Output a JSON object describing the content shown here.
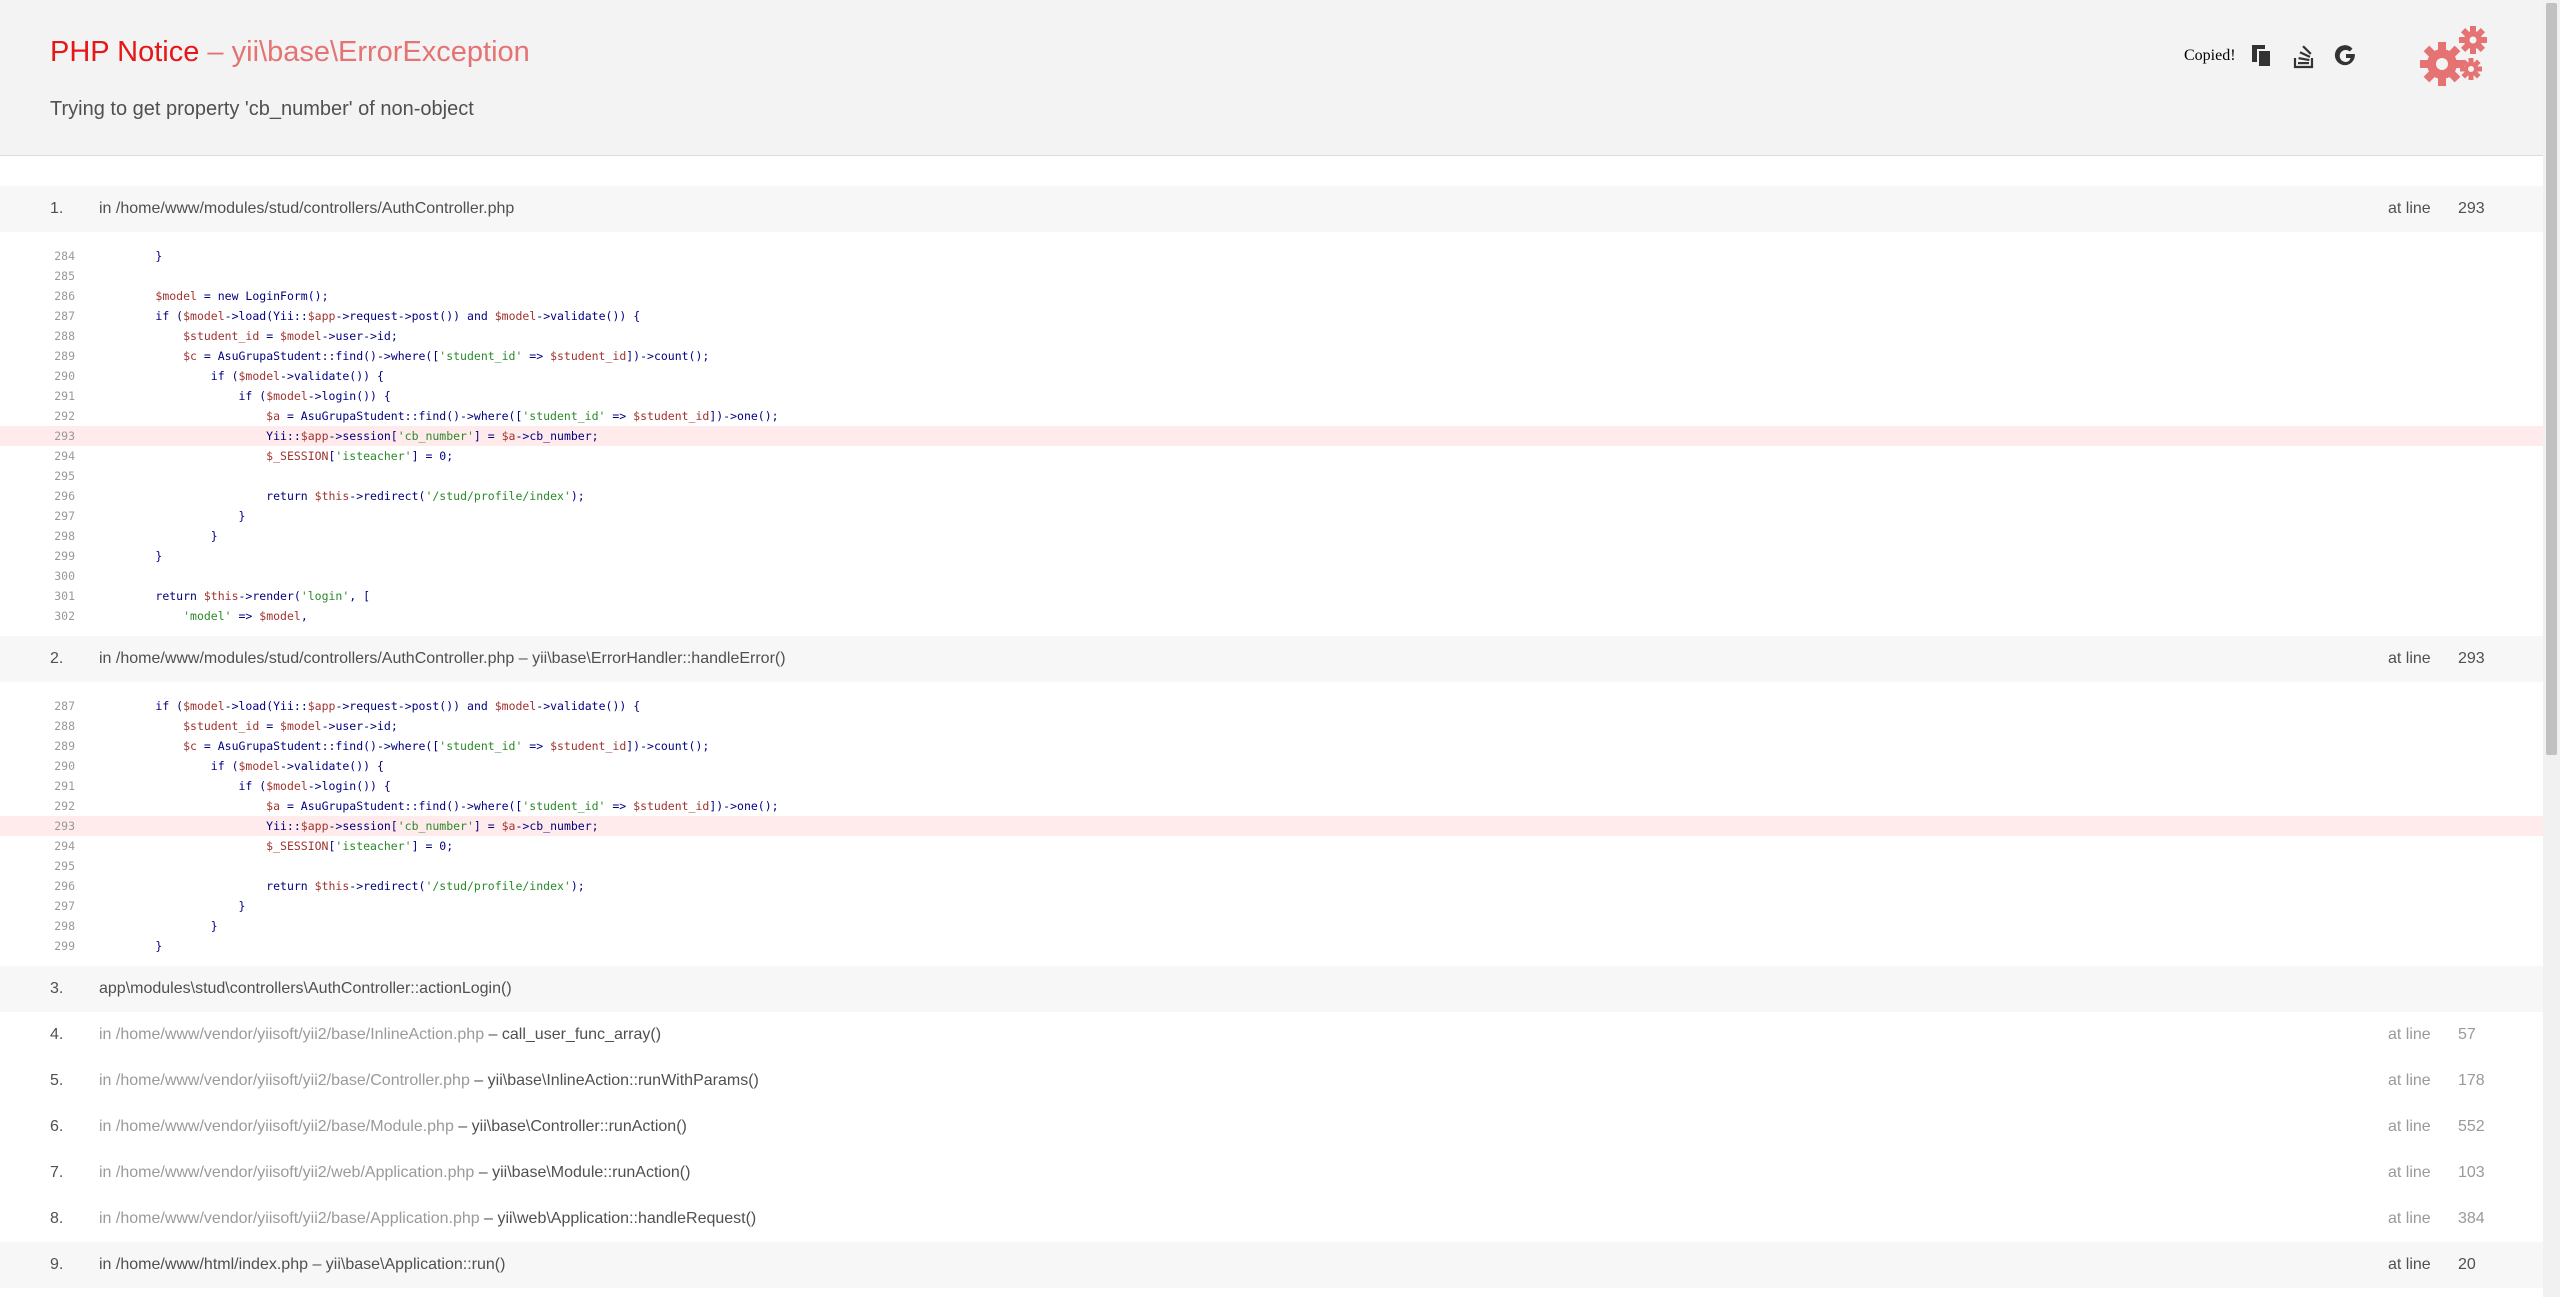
{
  "header": {
    "title": "PHP Notice",
    "title_sep": " – ",
    "exception": "yii\\base\\ErrorException",
    "message": "Trying to get property 'cb_number' of non-object",
    "copied_label": "Copied!",
    "icons": [
      "copy-icon",
      "stackoverflow-icon",
      "google-icon",
      "gear-logo"
    ]
  },
  "at_line_label": "at line",
  "frames": [
    {
      "num": "1.",
      "prefix": "in ",
      "path": "/home/www/modules/stud/controllers/AuthController.php",
      "call": "",
      "line": "293",
      "code": [
        [
          "284",
          "        }"
        ],
        [
          "285",
          ""
        ],
        [
          "286",
          "        $model = new LoginForm();"
        ],
        [
          "287",
          "        if ($model->load(Yii::$app->request->post()) and $model->validate()) {"
        ],
        [
          "288",
          "            $student_id = $model->user->id;"
        ],
        [
          "289",
          "            $c = AsuGrupaStudent::find()->where(['student_id' => $student_id])->count();"
        ],
        [
          "290",
          "                if ($model->validate()) {"
        ],
        [
          "291",
          "                    if ($model->login()) {"
        ],
        [
          "292",
          "                        $a = AsuGrupaStudent::find()->where(['student_id' => $student_id])->one();"
        ],
        [
          "293",
          "                        Yii::$app->session['cb_number'] = $a->cb_number;"
        ],
        [
          "294",
          "                        $_SESSION['isteacher'] = 0;"
        ],
        [
          "295",
          ""
        ],
        [
          "296",
          "                        return $this->redirect('/stud/profile/index');"
        ],
        [
          "297",
          "                    }"
        ],
        [
          "298",
          "                }"
        ],
        [
          "299",
          "        }"
        ],
        [
          "300",
          ""
        ],
        [
          "301",
          "        return $this->render('login', ["
        ],
        [
          "302",
          "            'model' => $model,"
        ]
      ]
    },
    {
      "num": "2.",
      "prefix": "in ",
      "path": "/home/www/modules/stud/controllers/AuthController.php",
      "call": " – yii\\base\\ErrorHandler::handleError()",
      "line": "293",
      "code": [
        [
          "287",
          "        if ($model->load(Yii::$app->request->post()) and $model->validate()) {"
        ],
        [
          "288",
          "            $student_id = $model->user->id;"
        ],
        [
          "289",
          "            $c = AsuGrupaStudent::find()->where(['student_id' => $student_id])->count();"
        ],
        [
          "290",
          "                if ($model->validate()) {"
        ],
        [
          "291",
          "                    if ($model->login()) {"
        ],
        [
          "292",
          "                        $a = AsuGrupaStudent::find()->where(['student_id' => $student_id])->one();"
        ],
        [
          "293",
          "                        Yii::$app->session['cb_number'] = $a->cb_number;"
        ],
        [
          "294",
          "                        $_SESSION['isteacher'] = 0;"
        ],
        [
          "295",
          ""
        ],
        [
          "296",
          "                        return $this->redirect('/stud/profile/index');"
        ],
        [
          "297",
          "                    }"
        ],
        [
          "298",
          "                }"
        ],
        [
          "299",
          "        }"
        ]
      ]
    },
    {
      "num": "3.",
      "prefix": "",
      "path": "",
      "call": "app\\modules\\stud\\controllers\\AuthController::actionLogin()",
      "line": "",
      "kind": "app"
    },
    {
      "num": "4.",
      "prefix": "in ",
      "path": "/home/www/vendor/yiisoft/yii2/base/InlineAction.php",
      "call": " – call_user_func_array()",
      "line": "57",
      "kind": "vendor"
    },
    {
      "num": "5.",
      "prefix": "in ",
      "path": "/home/www/vendor/yiisoft/yii2/base/Controller.php",
      "call": " – yii\\base\\InlineAction::runWithParams()",
      "line": "178",
      "kind": "vendor"
    },
    {
      "num": "6.",
      "prefix": "in ",
      "path": "/home/www/vendor/yiisoft/yii2/base/Module.php",
      "call": " – yii\\base\\Controller::runAction()",
      "line": "552",
      "kind": "vendor"
    },
    {
      "num": "7.",
      "prefix": "in ",
      "path": "/home/www/vendor/yiisoft/yii2/web/Application.php",
      "call": " – yii\\base\\Module::runAction()",
      "line": "103",
      "kind": "vendor"
    },
    {
      "num": "8.",
      "prefix": "in ",
      "path": "/home/www/vendor/yiisoft/yii2/base/Application.php",
      "call": " – yii\\web\\Application::handleRequest()",
      "line": "384",
      "kind": "vendor"
    },
    {
      "num": "9.",
      "prefix": "in ",
      "path": "/home/www/html/index.php",
      "call": " – yii\\base\\Application::run()",
      "line": "20",
      "kind": "app"
    }
  ],
  "highlight_line": "293",
  "colors": {
    "title": "#e51717",
    "exception": "#e57373",
    "highlight": "#ffebeb"
  }
}
